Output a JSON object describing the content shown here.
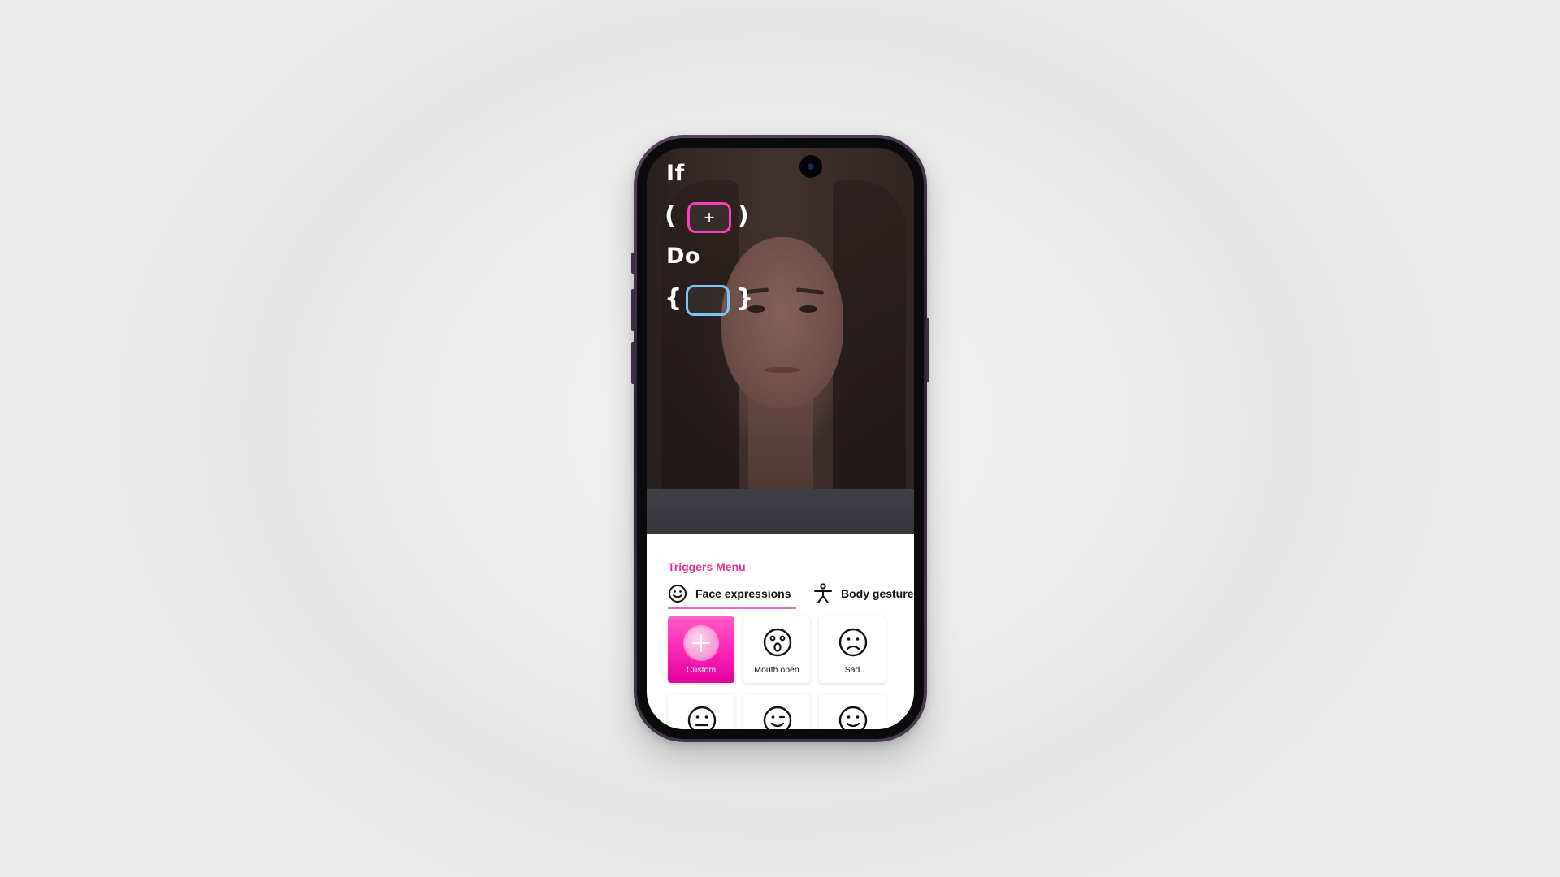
{
  "code": {
    "if_keyword": "If",
    "open_paren": "(",
    "close_paren": ")",
    "if_slot_symbol": "+",
    "do_keyword": "Do",
    "open_brace": "{",
    "close_brace": "}"
  },
  "triggers_menu": {
    "title": "Triggers Menu",
    "tabs": [
      {
        "label": "Face expressions",
        "icon": "smiley-icon",
        "active": true
      },
      {
        "label": "Body gestures",
        "icon": "person-icon",
        "active": false
      }
    ],
    "tiles": [
      {
        "label": "Custom",
        "icon": "plus-icon",
        "selected": true
      },
      {
        "label": "Mouth open",
        "icon": "surprised-face-icon",
        "selected": false
      },
      {
        "label": "Sad",
        "icon": "sad-face-icon",
        "selected": false
      },
      {
        "label": "",
        "icon": "neutral-face-icon",
        "selected": false
      },
      {
        "label": "",
        "icon": "wink-face-icon",
        "selected": false
      },
      {
        "label": "",
        "icon": "smile-face-icon",
        "selected": false
      }
    ]
  },
  "colors": {
    "accent_pink": "#e3339f",
    "if_slot_border": "#ff3fb6",
    "do_slot_border": "#7cc4f2"
  }
}
